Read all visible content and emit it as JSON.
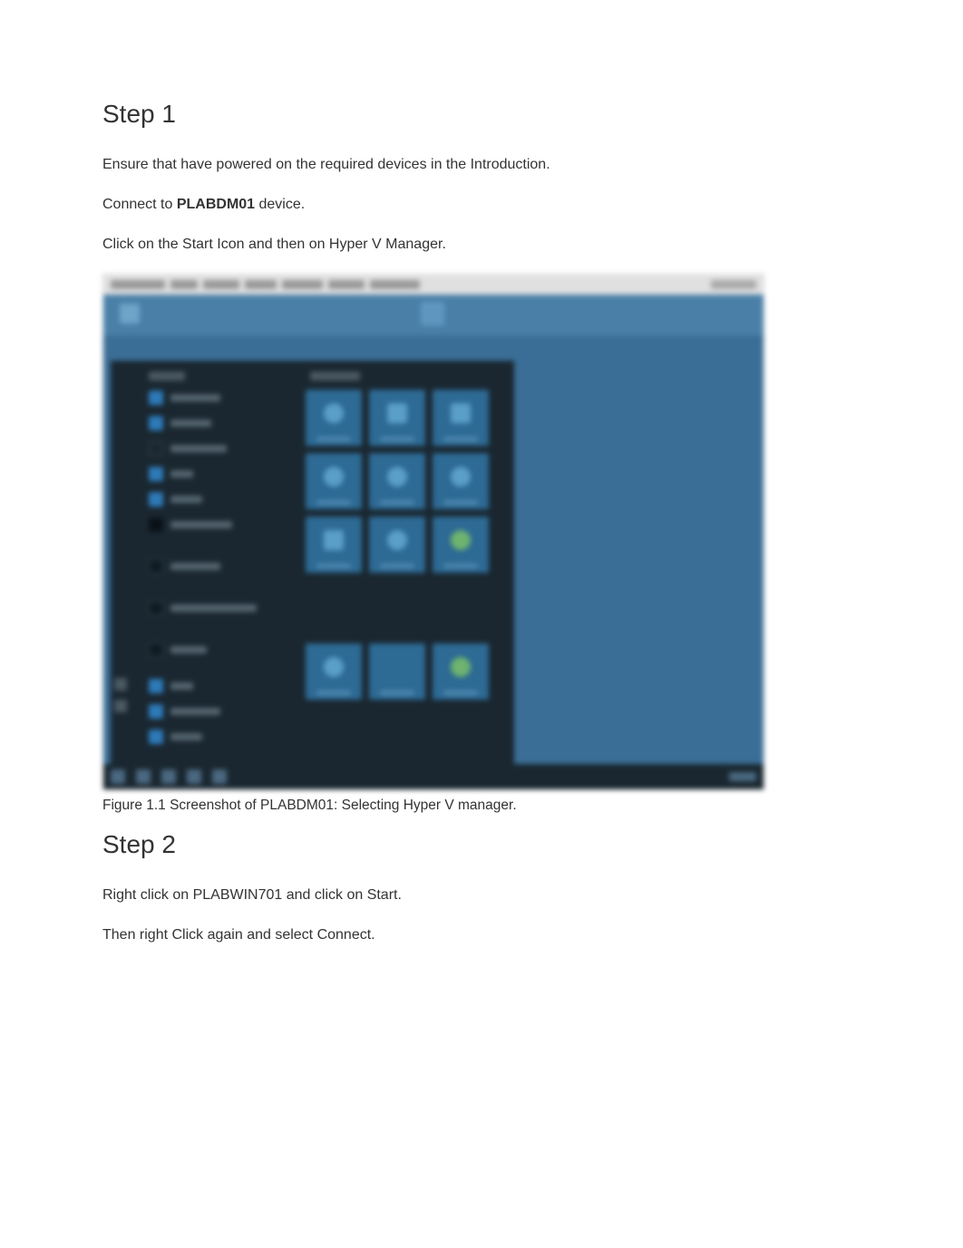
{
  "step1": {
    "heading": "Step 1",
    "p1": "Ensure that have powered on the required devices in the Introduction.",
    "p2_prefix": "Connect to ",
    "p2_bold": "PLABDM01",
    "p2_suffix": " device.",
    "p3": "Click on the Start Icon and then on Hyper V Manager."
  },
  "figure1": {
    "caption": "Figure 1.1 Screenshot of PLABDM01: Selecting Hyper V manager."
  },
  "step2": {
    "heading": "Step 2",
    "p1": "Right click on PLABWIN701 and click on Start.",
    "p2": "Then right Click again and select Connect."
  }
}
